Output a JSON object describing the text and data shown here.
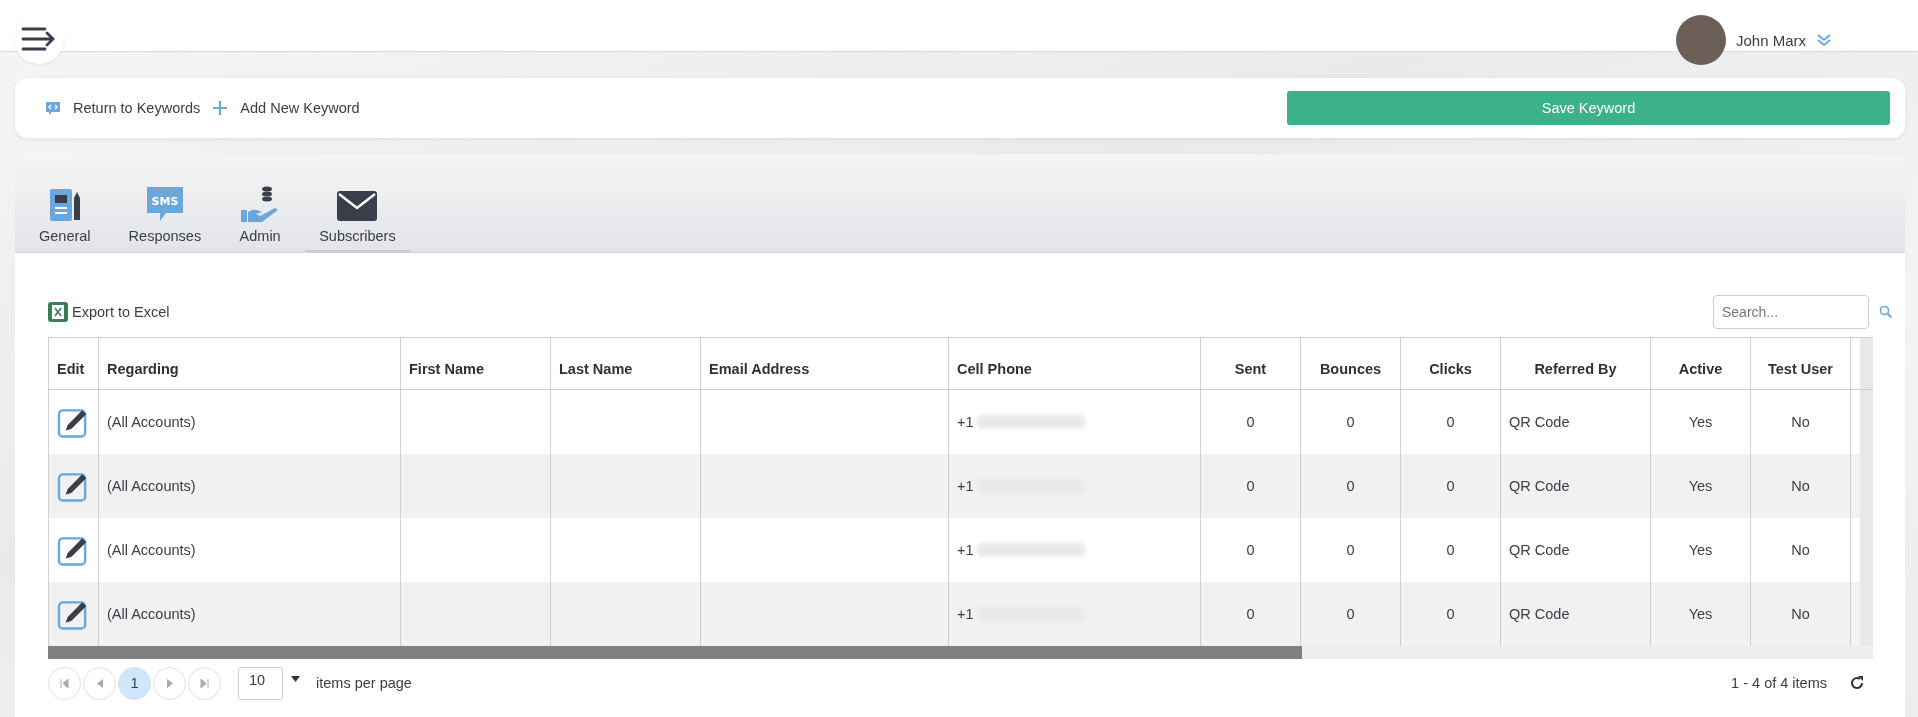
{
  "user": {
    "name": "John Marx"
  },
  "toolbar": {
    "links": [
      {
        "kind": "return",
        "label": "Return to Keywords"
      },
      {
        "kind": "add",
        "label": "Add New Keyword"
      }
    ],
    "save_button": "Save Keyword"
  },
  "tabs": [
    {
      "kind": "general",
      "label": "General",
      "selected": false
    },
    {
      "kind": "sms",
      "label": "Responses",
      "icon_text": "SMS",
      "selected": false
    },
    {
      "kind": "admin",
      "label": "Admin",
      "selected": false
    },
    {
      "kind": "mail",
      "label": "Subscribers",
      "selected": true
    }
  ],
  "export": "Export to Excel",
  "search": {
    "placeholder": "Search..."
  },
  "table": {
    "columns": [
      "Edit",
      "Regarding",
      "First Name",
      "Last Name",
      "Email Address",
      "Cell Phone",
      "Sent",
      "Bounces",
      "Clicks",
      "Referred By",
      "Active",
      "Test User"
    ],
    "rows": [
      {
        "regarding": "(All Accounts)",
        "cell_phone": "+1",
        "sent": "0",
        "bounces": "0",
        "clicks": "0",
        "referred_by": "QR Code",
        "active": "Yes",
        "test_user": "No"
      },
      {
        "regarding": "(All Accounts)",
        "cell_phone": "+1",
        "sent": "0",
        "bounces": "0",
        "clicks": "0",
        "referred_by": "QR Code",
        "active": "Yes",
        "test_user": "No"
      },
      {
        "regarding": "(All Accounts)",
        "cell_phone": "+1",
        "sent": "0",
        "bounces": "0",
        "clicks": "0",
        "referred_by": "QR Code",
        "active": "Yes",
        "test_user": "No"
      },
      {
        "regarding": "(All Accounts)",
        "cell_phone": "+1",
        "sent": "0",
        "bounces": "0",
        "clicks": "0",
        "referred_by": "QR Code",
        "active": "Yes",
        "test_user": "No"
      }
    ]
  },
  "pager": {
    "pages": [
      {
        "label": "1",
        "selected": true
      }
    ],
    "page_size": "10",
    "per_page_label": "items per page",
    "summary": "1 - 4 of 4 items"
  }
}
